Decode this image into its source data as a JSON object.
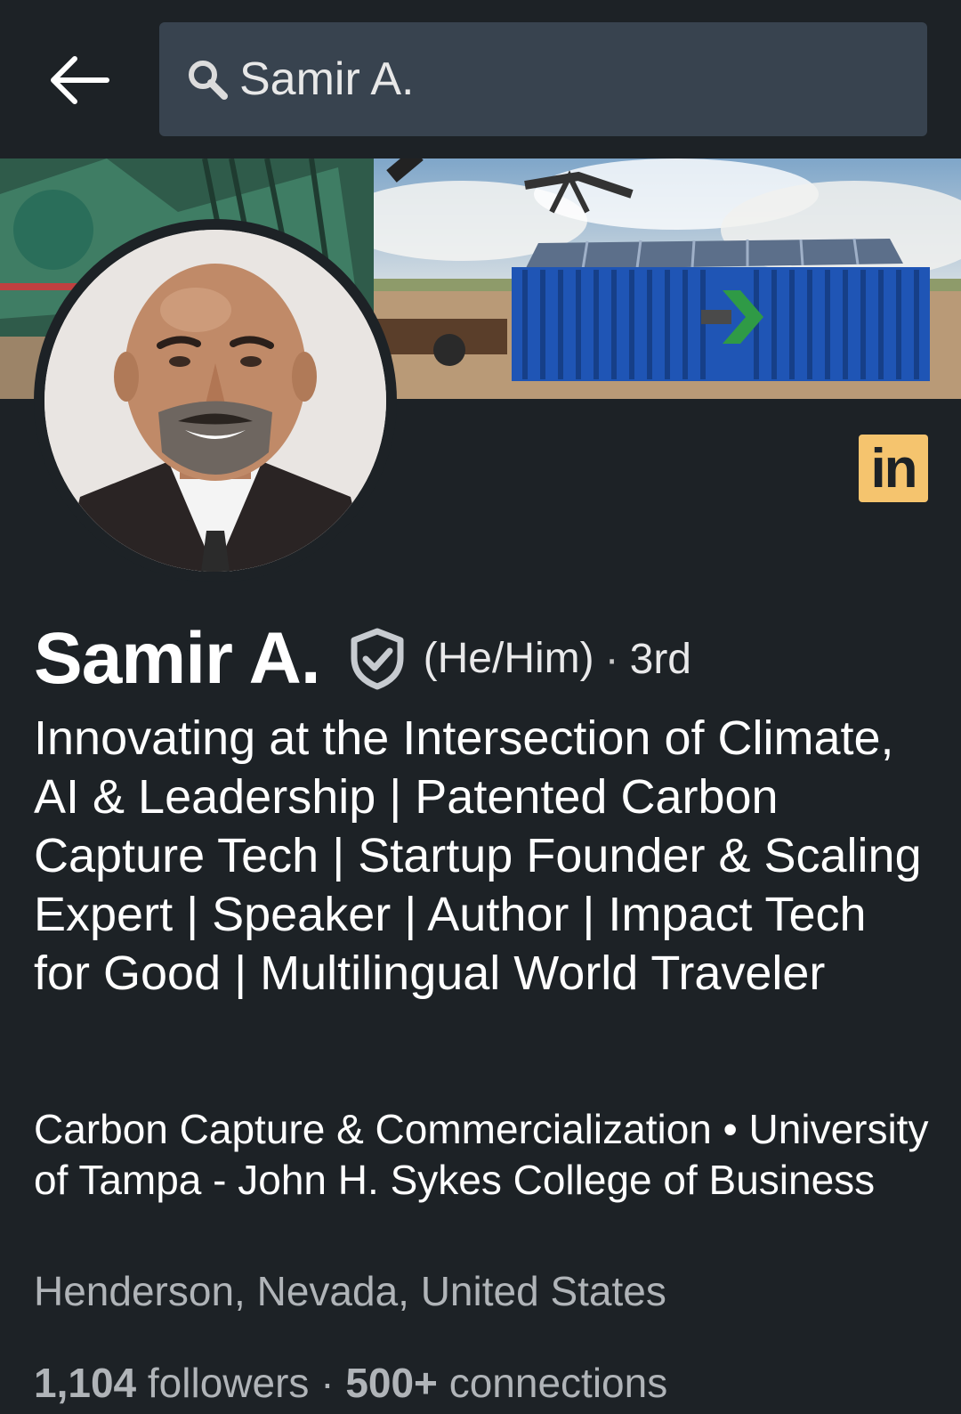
{
  "search": {
    "query": "Samir A.",
    "icon": "search-icon"
  },
  "nav": {
    "back_icon": "back-arrow-icon"
  },
  "badge": {
    "text": "in",
    "color": "#f5c46e"
  },
  "profile": {
    "name": "Samir A.",
    "verified_icon": "verified-shield-icon",
    "pronouns": "(He/Him)",
    "separator": "·",
    "degree": "3rd",
    "headline": "Innovating at the Intersection of Climate, AI & Leadership | Patented Carbon Capture Tech | Startup Founder & Scaling Expert | Speaker | Author | Impact Tech for Good | Multilingual World Traveler",
    "experience": "Carbon Capture & Commercialization • University of Tampa - John H. Sykes College of Business",
    "location": "Henderson, Nevada, United States",
    "followers_count": "1,104",
    "followers_label": "followers",
    "stats_separator": "·",
    "connections_count": "500+",
    "connections_label": "connections"
  },
  "colors": {
    "background": "#1d2226",
    "search_bg": "#38434f",
    "muted_text": "#b0b4b8"
  }
}
